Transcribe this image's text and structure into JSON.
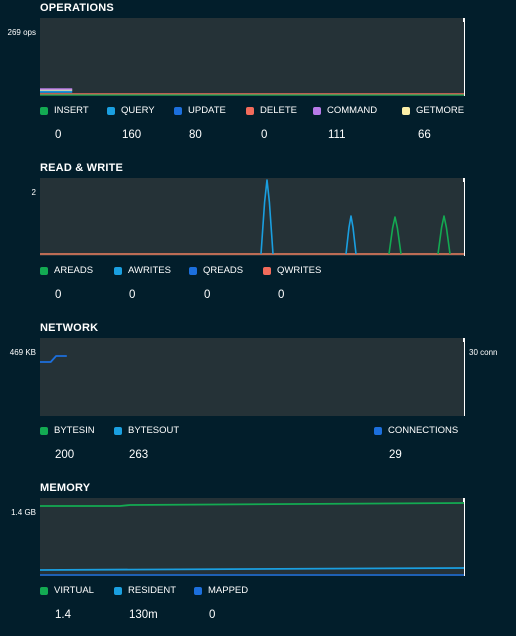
{
  "colors": {
    "insert": "#13aa52",
    "query": "#1a9fe0",
    "update": "#1c6fdd",
    "delete": "#f26b5b",
    "command": "#b77ae8",
    "getmore": "#fbefa8",
    "panel_bg": "#253237",
    "page_bg": "#021e2b"
  },
  "operations": {
    "title": "OPERATIONS",
    "y_label": "269 ops",
    "legend": [
      {
        "label": "INSERT",
        "value": "0",
        "color": "#13aa52"
      },
      {
        "label": "QUERY",
        "value": "160",
        "color": "#1a9fe0"
      },
      {
        "label": "UPDATE",
        "value": "80",
        "color": "#1c6fdd"
      },
      {
        "label": "DELETE",
        "value": "0",
        "color": "#f26b5b"
      },
      {
        "label": "COMMAND",
        "value": "111",
        "color": "#b77ae8"
      },
      {
        "label": "GETMORE",
        "value": "66",
        "color": "#fbefa8"
      }
    ]
  },
  "read_write": {
    "title": "READ & WRITE",
    "y_label": "2",
    "legend": [
      {
        "label": "AREADS",
        "value": "0",
        "color": "#13aa52"
      },
      {
        "label": "AWRITES",
        "value": "0",
        "color": "#1a9fe0"
      },
      {
        "label": "QREADS",
        "value": "0",
        "color": "#1c6fdd"
      },
      {
        "label": "QWRITES",
        "value": "0",
        "color": "#f26b5b"
      }
    ]
  },
  "network": {
    "title": "NETWORK",
    "y_label": "469 KB",
    "y_label_right": "30 conn",
    "legend": [
      {
        "label": "BYTESIN",
        "value": "200",
        "color": "#13aa52"
      },
      {
        "label": "BYTESOUT",
        "value": "263",
        "color": "#1a9fe0"
      },
      {
        "label": "CONNECTIONS",
        "value": "29",
        "color": "#1c6fdd"
      }
    ]
  },
  "memory": {
    "title": "MEMORY",
    "y_label": "1.4 GB",
    "legend": [
      {
        "label": "VIRTUAL",
        "value": "1.4",
        "color": "#13aa52"
      },
      {
        "label": "RESIDENT",
        "value": "130m",
        "color": "#1a9fe0"
      },
      {
        "label": "MAPPED",
        "value": "0",
        "color": "#1c6fdd"
      }
    ]
  }
}
